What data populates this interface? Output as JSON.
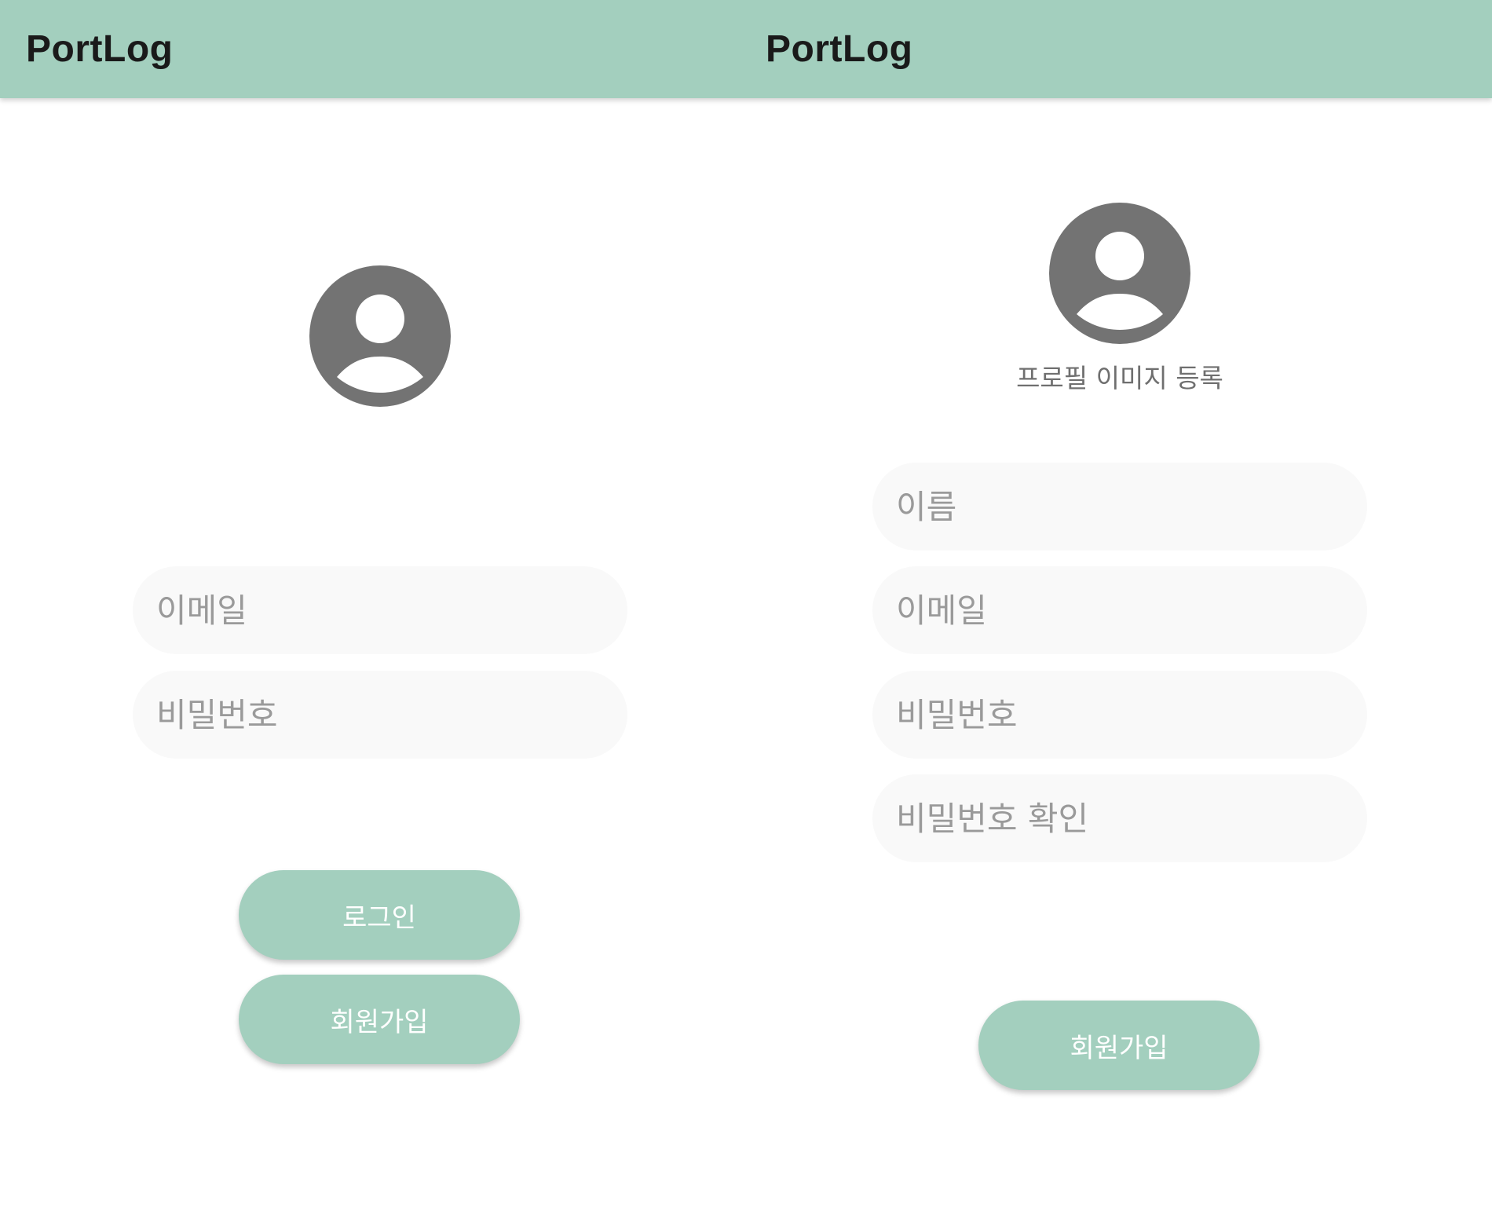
{
  "colors": {
    "accent": "#a3cfbe",
    "field_background": "#f9f9f9",
    "placeholder_text": "#9a9a9a",
    "avatar_gray": "#737373",
    "title_text": "#1a1a1a"
  },
  "login_screen": {
    "app_title": "PortLog",
    "avatar_icon": "account-circle-icon",
    "email_placeholder": "이메일",
    "password_placeholder": "비밀번호",
    "login_label": "로그인",
    "signup_label": "회원가입"
  },
  "signup_screen": {
    "app_title": "PortLog",
    "avatar_icon": "account-circle-icon",
    "profile_image_caption": "프로필 이미지 등록",
    "name_placeholder": "이름",
    "email_placeholder": "이메일",
    "password_placeholder": "비밀번호",
    "password_confirm_placeholder": "비밀번호 확인",
    "signup_label": "회원가입"
  }
}
